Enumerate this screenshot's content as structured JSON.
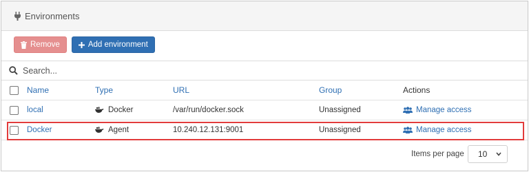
{
  "header": {
    "title": "Environments",
    "icon": "plug-icon"
  },
  "toolbar": {
    "remove_label": "Remove",
    "add_label": "Add environment"
  },
  "search": {
    "placeholder": "Search..."
  },
  "table": {
    "columns": {
      "name": "Name",
      "type": "Type",
      "url": "URL",
      "group": "Group",
      "actions": "Actions"
    },
    "rows": [
      {
        "name": "local",
        "type": "Docker",
        "url": "/var/run/docker.sock",
        "group": "Unassigned",
        "action": "Manage access"
      },
      {
        "name": "Docker",
        "type": "Agent",
        "url": "10.240.12.131:9001",
        "group": "Unassigned",
        "action": "Manage access"
      }
    ]
  },
  "pagination": {
    "label": "Items per page",
    "value": "10"
  },
  "colors": {
    "accent": "#2f6fb3",
    "danger": "#e58f8f",
    "highlight": "#e23b3b"
  }
}
